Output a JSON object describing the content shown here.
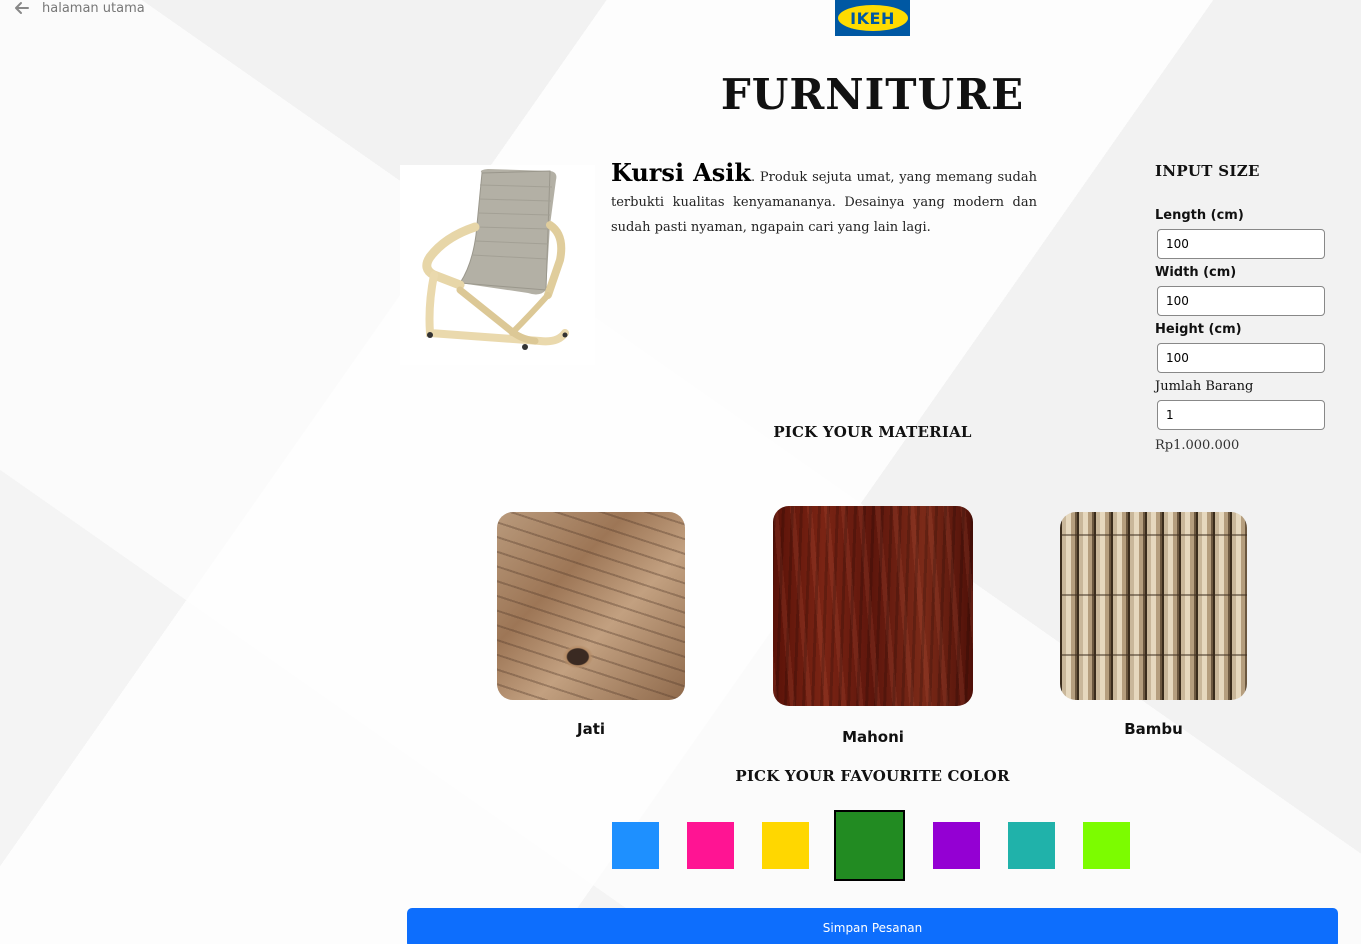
{
  "nav": {
    "back_label": "halaman utama"
  },
  "logo": {
    "text": "IKEH",
    "bg": "#0058a3",
    "fg": "#ffdb00"
  },
  "page_title": "FURNITURE",
  "product": {
    "name": "Kursi Asik",
    "description": ". Produk sejuta umat, yang memang sudah terbukti kualitas kenyamananya. Desainya yang modern dan sudah pasti nyaman, ngapain cari yang lain lagi."
  },
  "size": {
    "heading": "INPUT SIZE",
    "length_label": "Length (cm)",
    "length_value": "100",
    "width_label": "Width (cm)",
    "width_value": "100",
    "height_label": "Height (cm)",
    "height_value": "100",
    "qty_label": "Jumlah Barang",
    "qty_value": "1",
    "price": "Rp1.000.000"
  },
  "material": {
    "heading": "PICK YOUR MATERIAL",
    "options": [
      {
        "name": "Jati"
      },
      {
        "name": "Mahoni"
      },
      {
        "name": "Bambu"
      }
    ],
    "selected": "Mahoni"
  },
  "color": {
    "heading": "PICK YOUR FAVOURITE COLOR",
    "options": [
      "#1e90ff",
      "#ff1493",
      "#ffd700",
      "#228b22",
      "#9400d3",
      "#20b2aa",
      "#7cfc00"
    ],
    "selected": "#228b22"
  },
  "submit_label": "Simpan Pesanan"
}
